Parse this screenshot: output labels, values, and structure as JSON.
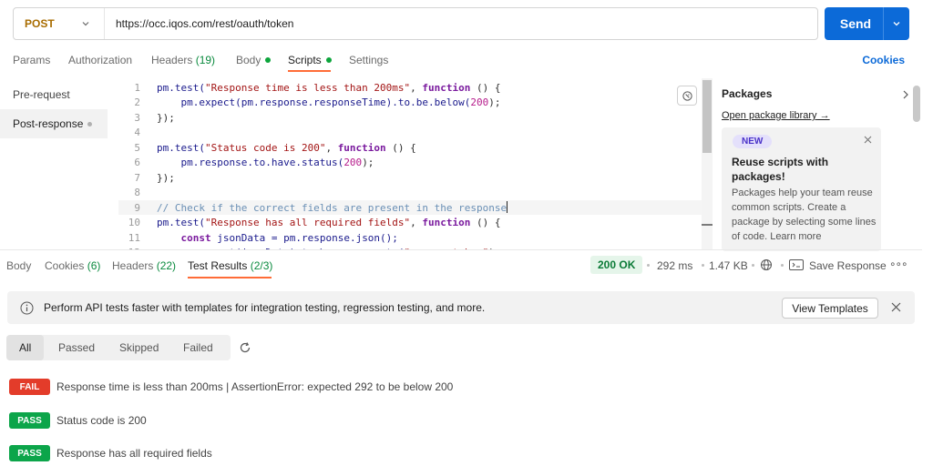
{
  "request": {
    "method": "POST",
    "url": "https://occ.iqos.com/rest/oauth/token",
    "send_label": "Send"
  },
  "tabs": [
    {
      "label": "Params"
    },
    {
      "label": "Authorization"
    },
    {
      "label": "Headers",
      "count": "(19)"
    },
    {
      "label": "Body"
    },
    {
      "label": "Scripts"
    },
    {
      "label": "Settings"
    }
  ],
  "cookies_label": "Cookies",
  "scripts_nav": [
    "Pre-request",
    "Post-response"
  ],
  "code": {
    "lines": [
      {
        "n": "1",
        "tokens": [
          {
            "t": "pm.test(",
            "c": "fn"
          },
          {
            "t": "\"Response time is less than 200ms\"",
            "c": "str"
          },
          {
            "t": ", ",
            "c": "pl"
          },
          {
            "t": "function",
            "c": "kw"
          },
          {
            "t": " () {",
            "c": "pl"
          }
        ]
      },
      {
        "n": "2",
        "tokens": [
          {
            "t": "    pm.expect(pm.response.responseTime).to.be.below(",
            "c": "fn"
          },
          {
            "t": "200",
            "c": "num"
          },
          {
            "t": ");",
            "c": "pl"
          }
        ]
      },
      {
        "n": "3",
        "tokens": [
          {
            "t": "});",
            "c": "pl"
          }
        ]
      },
      {
        "n": "4",
        "tokens": []
      },
      {
        "n": "5",
        "tokens": [
          {
            "t": "pm.test(",
            "c": "fn"
          },
          {
            "t": "\"Status code is 200\"",
            "c": "str"
          },
          {
            "t": ", ",
            "c": "pl"
          },
          {
            "t": "function",
            "c": "kw"
          },
          {
            "t": " () {",
            "c": "pl"
          }
        ]
      },
      {
        "n": "6",
        "tokens": [
          {
            "t": "    pm.response.to.have.status(",
            "c": "fn"
          },
          {
            "t": "200",
            "c": "num"
          },
          {
            "t": ");",
            "c": "pl"
          }
        ]
      },
      {
        "n": "7",
        "tokens": [
          {
            "t": "});",
            "c": "pl"
          }
        ]
      },
      {
        "n": "8",
        "tokens": []
      },
      {
        "n": "9",
        "tokens": [
          {
            "t": "// Check if the correct fields are present in the response",
            "c": "cm"
          }
        ],
        "cursor": true
      },
      {
        "n": "10",
        "tokens": [
          {
            "t": "pm.test(",
            "c": "fn"
          },
          {
            "t": "\"Response has all required fields\"",
            "c": "str"
          },
          {
            "t": ", ",
            "c": "pl"
          },
          {
            "t": "function",
            "c": "kw"
          },
          {
            "t": " () {",
            "c": "pl"
          }
        ]
      },
      {
        "n": "11",
        "tokens": [
          {
            "t": "    ",
            "c": "pl"
          },
          {
            "t": "const",
            "c": "kw"
          },
          {
            "t": " jsonData = pm.response.json();",
            "c": "fn"
          }
        ]
      },
      {
        "n": "12",
        "tokens": [
          {
            "t": "    pm.expect(jsonData).to.have.property(",
            "c": "fn"
          },
          {
            "t": "\"access_token\"",
            "c": "str"
          },
          {
            "t": ");",
            "c": "pl"
          }
        ]
      }
    ]
  },
  "packages": {
    "title": "Packages",
    "link": "Open package library",
    "badge": "NEW",
    "heading": "Reuse scripts with packages!",
    "body": "Packages help your team reuse common scripts. Create a package by selecting some lines of code. Learn more"
  },
  "response": {
    "tabs": [
      {
        "label": "Body"
      },
      {
        "label": "Cookies",
        "count": "(6)"
      },
      {
        "label": "Headers",
        "count": "(22)"
      },
      {
        "label": "Test Results",
        "count": "(2/3)"
      }
    ],
    "status": "200 OK",
    "time": "292 ms",
    "size": "1.47 KB",
    "save_label": "Save Response",
    "more": "∘∘∘"
  },
  "banner": {
    "text": "Perform API tests faster with templates for integration testing, regression testing, and more.",
    "button": "View Templates"
  },
  "filters": [
    "All",
    "Passed",
    "Skipped",
    "Failed"
  ],
  "results": [
    {
      "status": "FAIL",
      "text": "Response time is less than 200ms | AssertionError: expected 292 to be below 200"
    },
    {
      "status": "PASS",
      "text": "Status code is 200"
    },
    {
      "status": "PASS",
      "text": "Response has all required fields"
    }
  ],
  "colors": {
    "accent": "#0c6ad8",
    "tab_underline": "#ff6c37",
    "fail": "#e33c2a",
    "pass": "#0ca54a",
    "method": "#a86c00"
  }
}
